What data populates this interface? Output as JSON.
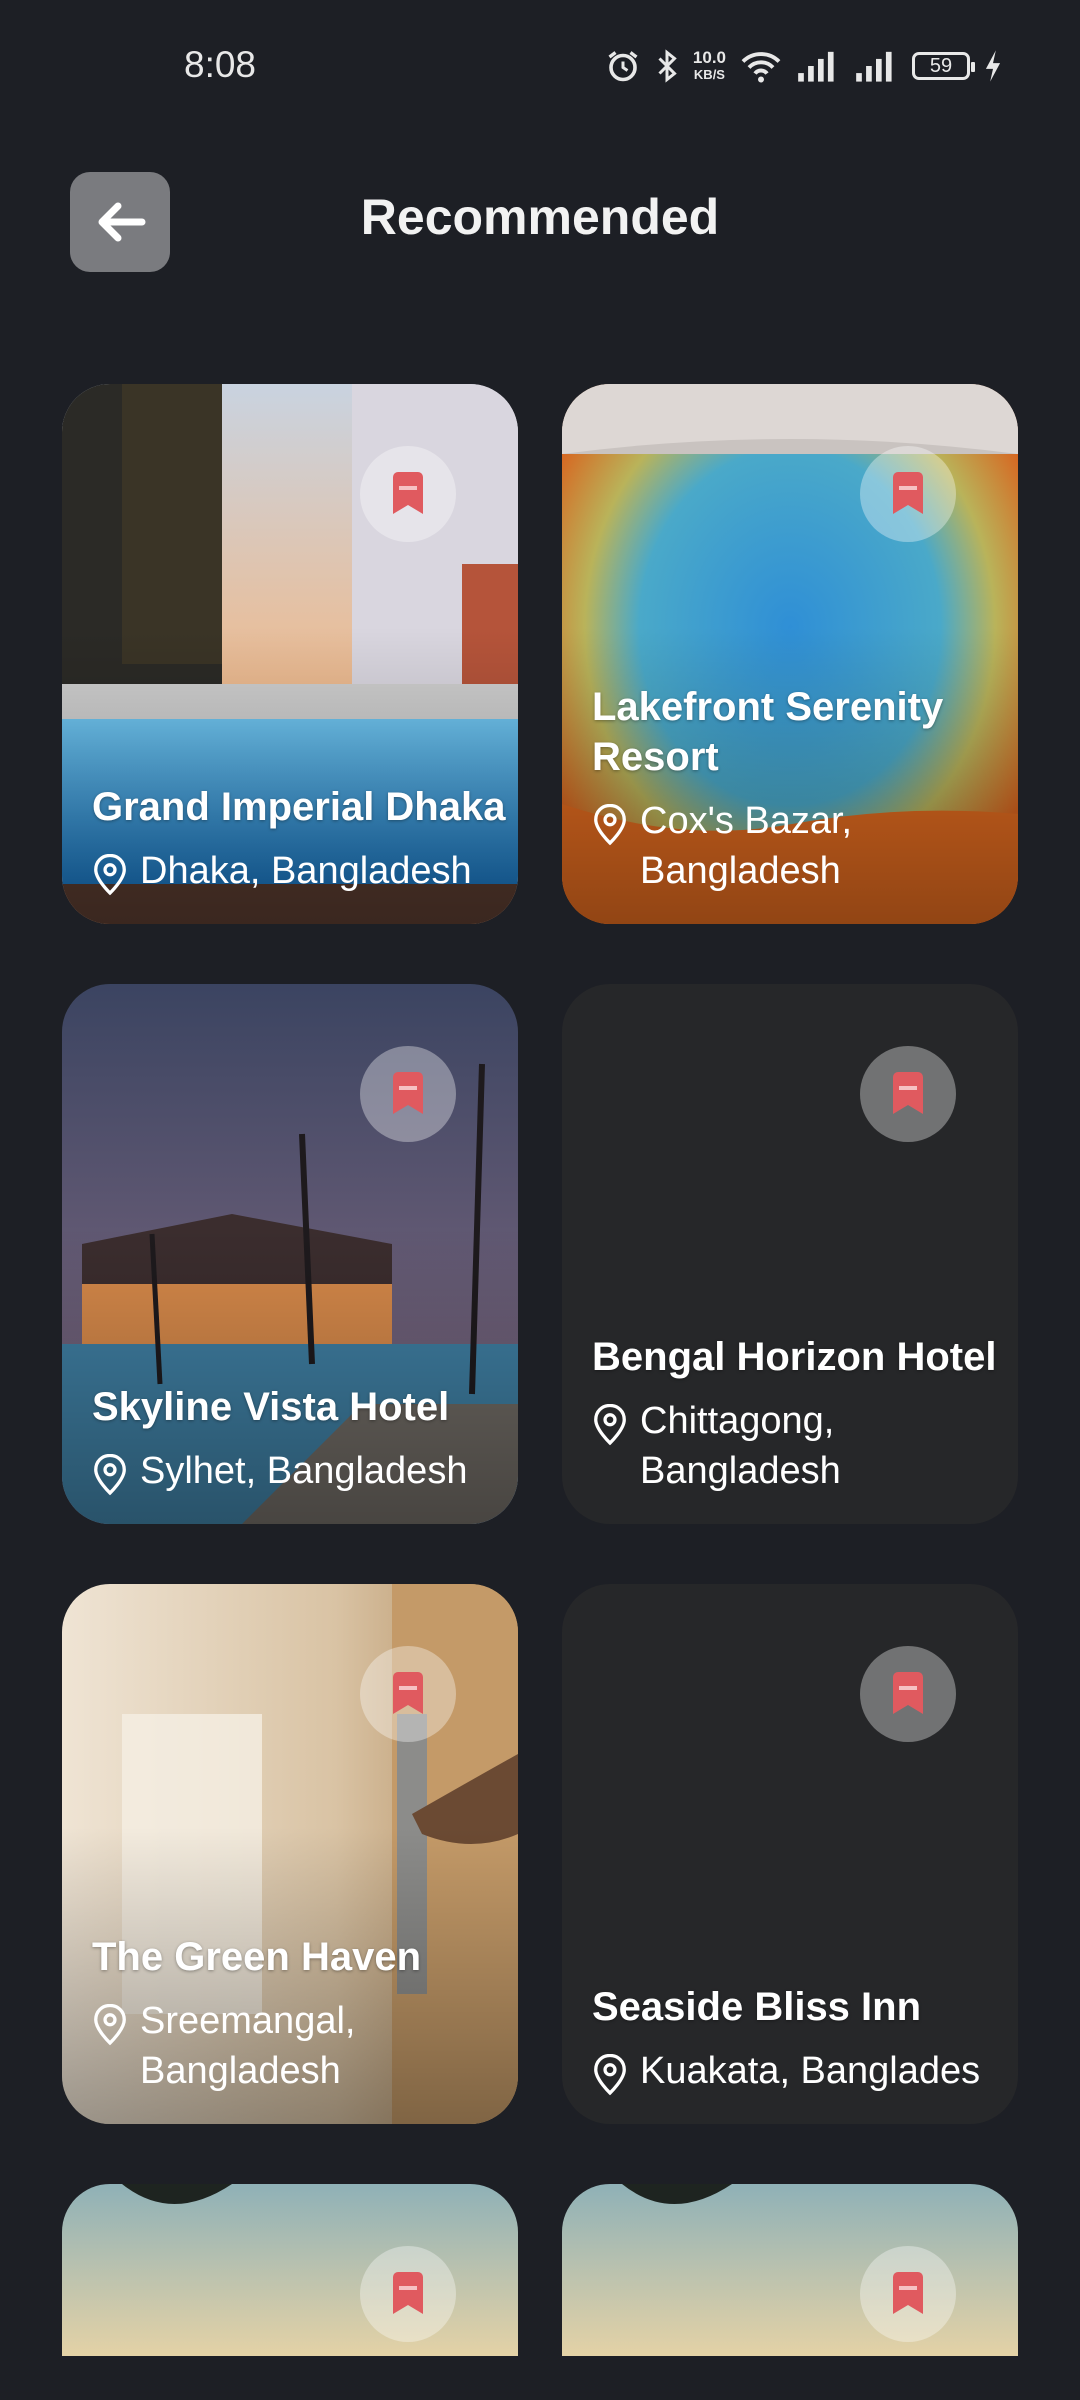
{
  "status_bar": {
    "time": "8:08",
    "speed_value": "10.0",
    "speed_unit": "KB/S",
    "battery": "59"
  },
  "header": {
    "title": "Recommended",
    "back_icon": "arrow-left-icon"
  },
  "hotels": [
    {
      "name": "Grand Imperial Dhaka",
      "location": "Dhaka, Bangladesh"
    },
    {
      "name": "Lakefront Serenity Resort",
      "location": "Cox's Bazar, Bangladesh"
    },
    {
      "name": "Skyline Vista Hotel",
      "location": "Sylhet, Bangladesh"
    },
    {
      "name": "Bengal Horizon Hotel",
      "location": "Chittagong, Bangladesh"
    },
    {
      "name": "The Green Haven",
      "location": "Sreemangal, Bangladesh"
    },
    {
      "name": "Seaside Bliss Inn",
      "location": "Kuakata, Banglades"
    }
  ],
  "colors": {
    "background": "#1d1f25",
    "card": "#262729",
    "bookmark_icon": "#e05a5f"
  }
}
